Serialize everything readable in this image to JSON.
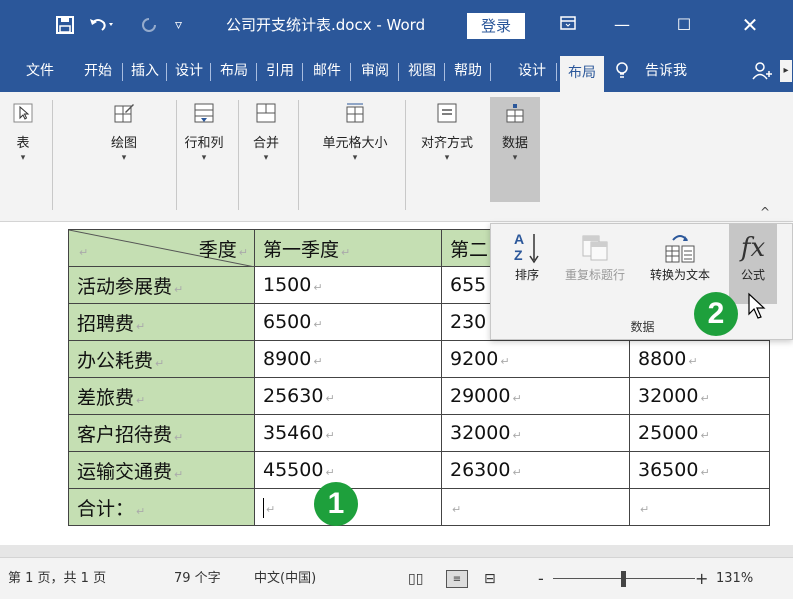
{
  "titlebar": {
    "doc_title": "公司开支统计表.docx - Word",
    "login": "登录",
    "icons": [
      "save-icon",
      "undo-icon",
      "redo-icon",
      "customize-icon",
      "ribbon-display-icon",
      "minimize-icon",
      "maximize-icon",
      "close-icon"
    ]
  },
  "tabs": [
    {
      "label": "文件"
    },
    {
      "label": "开始"
    },
    {
      "label": "插入"
    },
    {
      "label": "设计"
    },
    {
      "label": "布局"
    },
    {
      "label": "引用"
    },
    {
      "label": "邮件"
    },
    {
      "label": "审阅"
    },
    {
      "label": "视图"
    },
    {
      "label": "帮助"
    },
    {
      "label": "设计"
    },
    {
      "label": "布局"
    },
    {
      "label": "告诉我"
    }
  ],
  "ribbon": {
    "buttons": [
      {
        "label": "表"
      },
      {
        "label": "绘图"
      },
      {
        "label": "行和列"
      },
      {
        "label": "合并"
      },
      {
        "label": "单元格大小"
      },
      {
        "label": "对齐方式"
      },
      {
        "label": "数据"
      }
    ]
  },
  "panel": {
    "sort": "排序",
    "repeat_header": "重复标题行",
    "to_text": "转换为文本",
    "formula": "公式",
    "formula_symbol": "fx",
    "group_label": "数据"
  },
  "table": {
    "header": [
      "季度",
      "第一季度",
      "第二"
    ],
    "rows": [
      [
        "活动参展费",
        "1500",
        "655",
        ""
      ],
      [
        "招聘费",
        "6500",
        "230",
        ""
      ],
      [
        "办公耗费",
        "8900",
        "9200",
        "8800"
      ],
      [
        "差旅费",
        "25630",
        "29000",
        "32000"
      ],
      [
        "客户招待费",
        "35460",
        "32000",
        "25000"
      ],
      [
        "运输交通费",
        "45500",
        "26300",
        "36500"
      ],
      [
        "合计：",
        "",
        "",
        ""
      ]
    ]
  },
  "markers": {
    "one": "1",
    "two": "2"
  },
  "status": {
    "page": "第 1 页，共 1 页",
    "words": "79 个字",
    "lang": "中文(中国)",
    "zoom": "131%"
  }
}
